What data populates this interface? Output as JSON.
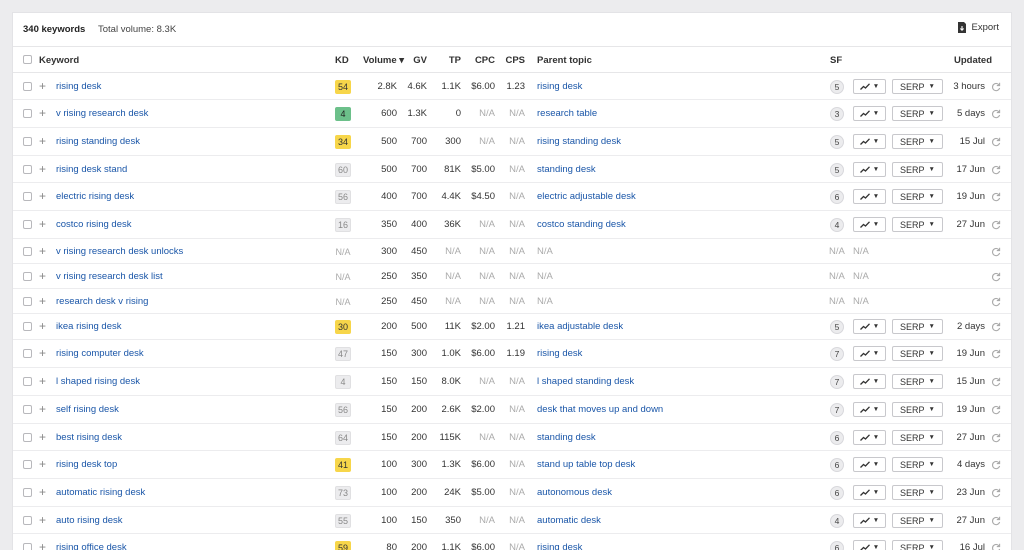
{
  "summary": {
    "count": "340 keywords",
    "total_volume": "Total volume: 8.3K",
    "export_label": "Export"
  },
  "columns": {
    "keyword": "Keyword",
    "kd": "KD",
    "volume": "Volume ▾",
    "gv": "GV",
    "tp": "TP",
    "cpc": "CPC",
    "cps": "CPS",
    "parent": "Parent topic",
    "sf": "SF",
    "updated": "Updated"
  },
  "serp_label": "SERP",
  "rows": [
    {
      "keyword": "rising desk",
      "kd": "54",
      "kd_type": "y",
      "volume": "2.8K",
      "gv": "4.6K",
      "tp": "1.1K",
      "cpc": "$6.00",
      "cps": "1.23",
      "parent": "rising desk",
      "sf": "5",
      "updated": "3 hours"
    },
    {
      "keyword": "v rising research desk",
      "kd": "4",
      "kd_type": "g",
      "volume": "600",
      "gv": "1.3K",
      "tp": "0",
      "cpc": "N/A",
      "cps": "N/A",
      "parent": "research table",
      "sf": "3",
      "updated": "5 days"
    },
    {
      "keyword": "rising standing desk",
      "kd": "34",
      "kd_type": "y",
      "volume": "500",
      "gv": "700",
      "tp": "300",
      "cpc": "N/A",
      "cps": "N/A",
      "parent": "rising standing desk",
      "sf": "5",
      "updated": "15 Jul"
    },
    {
      "keyword": "rising desk stand",
      "kd": "60",
      "kd_type": "n",
      "volume": "500",
      "gv": "700",
      "tp": "81K",
      "cpc": "$5.00",
      "cps": "N/A",
      "parent": "standing desk",
      "sf": "5",
      "updated": "17 Jun"
    },
    {
      "keyword": "electric rising desk",
      "kd": "56",
      "kd_type": "n",
      "volume": "400",
      "gv": "700",
      "tp": "4.4K",
      "cpc": "$4.50",
      "cps": "N/A",
      "parent": "electric adjustable desk",
      "sf": "6",
      "updated": "19 Jun"
    },
    {
      "keyword": "costco rising desk",
      "kd": "16",
      "kd_type": "n",
      "volume": "350",
      "gv": "400",
      "tp": "36K",
      "cpc": "N/A",
      "cps": "N/A",
      "parent": "costco standing desk",
      "sf": "4",
      "updated": "27 Jun"
    },
    {
      "keyword": "v rising research desk unlocks",
      "kd": "N/A",
      "kd_type": "na",
      "volume": "300",
      "gv": "450",
      "tp": "N/A",
      "cpc": "N/A",
      "cps": "N/A",
      "parent": "N/A",
      "sf": "N/A",
      "sf2": "N/A",
      "updated": ""
    },
    {
      "keyword": "v rising research desk list",
      "kd": "N/A",
      "kd_type": "na",
      "volume": "250",
      "gv": "350",
      "tp": "N/A",
      "cpc": "N/A",
      "cps": "N/A",
      "parent": "N/A",
      "sf": "N/A",
      "sf2": "N/A",
      "updated": ""
    },
    {
      "keyword": "research desk v rising",
      "kd": "N/A",
      "kd_type": "na",
      "volume": "250",
      "gv": "450",
      "tp": "N/A",
      "cpc": "N/A",
      "cps": "N/A",
      "parent": "N/A",
      "sf": "N/A",
      "sf2": "N/A",
      "updated": ""
    },
    {
      "keyword": "ikea rising desk",
      "kd": "30",
      "kd_type": "y",
      "volume": "200",
      "gv": "500",
      "tp": "11K",
      "cpc": "$2.00",
      "cps": "1.21",
      "parent": "ikea adjustable desk",
      "sf": "5",
      "updated": "2 days"
    },
    {
      "keyword": "rising computer desk",
      "kd": "47",
      "kd_type": "n",
      "volume": "150",
      "gv": "300",
      "tp": "1.0K",
      "cpc": "$6.00",
      "cps": "1.19",
      "parent": "rising desk",
      "sf": "7",
      "updated": "19 Jun"
    },
    {
      "keyword": "l shaped rising desk",
      "kd": "4",
      "kd_type": "n",
      "volume": "150",
      "gv": "150",
      "tp": "8.0K",
      "cpc": "N/A",
      "cps": "N/A",
      "parent": "l shaped standing desk",
      "sf": "7",
      "updated": "15 Jun"
    },
    {
      "keyword": "self rising desk",
      "kd": "56",
      "kd_type": "n",
      "volume": "150",
      "gv": "200",
      "tp": "2.6K",
      "cpc": "$2.00",
      "cps": "N/A",
      "parent": "desk that moves up and down",
      "sf": "7",
      "updated": "19 Jun"
    },
    {
      "keyword": "best rising desk",
      "kd": "64",
      "kd_type": "n",
      "volume": "150",
      "gv": "200",
      "tp": "115K",
      "cpc": "N/A",
      "cps": "N/A",
      "parent": "standing desk",
      "sf": "6",
      "updated": "27 Jun"
    },
    {
      "keyword": "rising desk top",
      "kd": "41",
      "kd_type": "y",
      "volume": "100",
      "gv": "300",
      "tp": "1.3K",
      "cpc": "$6.00",
      "cps": "N/A",
      "parent": "stand up table top desk",
      "sf": "6",
      "updated": "4 days"
    },
    {
      "keyword": "automatic rising desk",
      "kd": "73",
      "kd_type": "n",
      "volume": "100",
      "gv": "200",
      "tp": "24K",
      "cpc": "$5.00",
      "cps": "N/A",
      "parent": "autonomous desk",
      "sf": "6",
      "updated": "23 Jun"
    },
    {
      "keyword": "auto rising desk",
      "kd": "55",
      "kd_type": "n",
      "volume": "100",
      "gv": "150",
      "tp": "350",
      "cpc": "N/A",
      "cps": "N/A",
      "parent": "automatic desk",
      "sf": "4",
      "updated": "27 Jun"
    },
    {
      "keyword": "rising office desk",
      "kd": "59",
      "kd_type": "y",
      "volume": "80",
      "gv": "200",
      "tp": "1.1K",
      "cpc": "$6.00",
      "cps": "N/A",
      "parent": "rising desk",
      "sf": "6",
      "updated": "16 Jul"
    }
  ]
}
